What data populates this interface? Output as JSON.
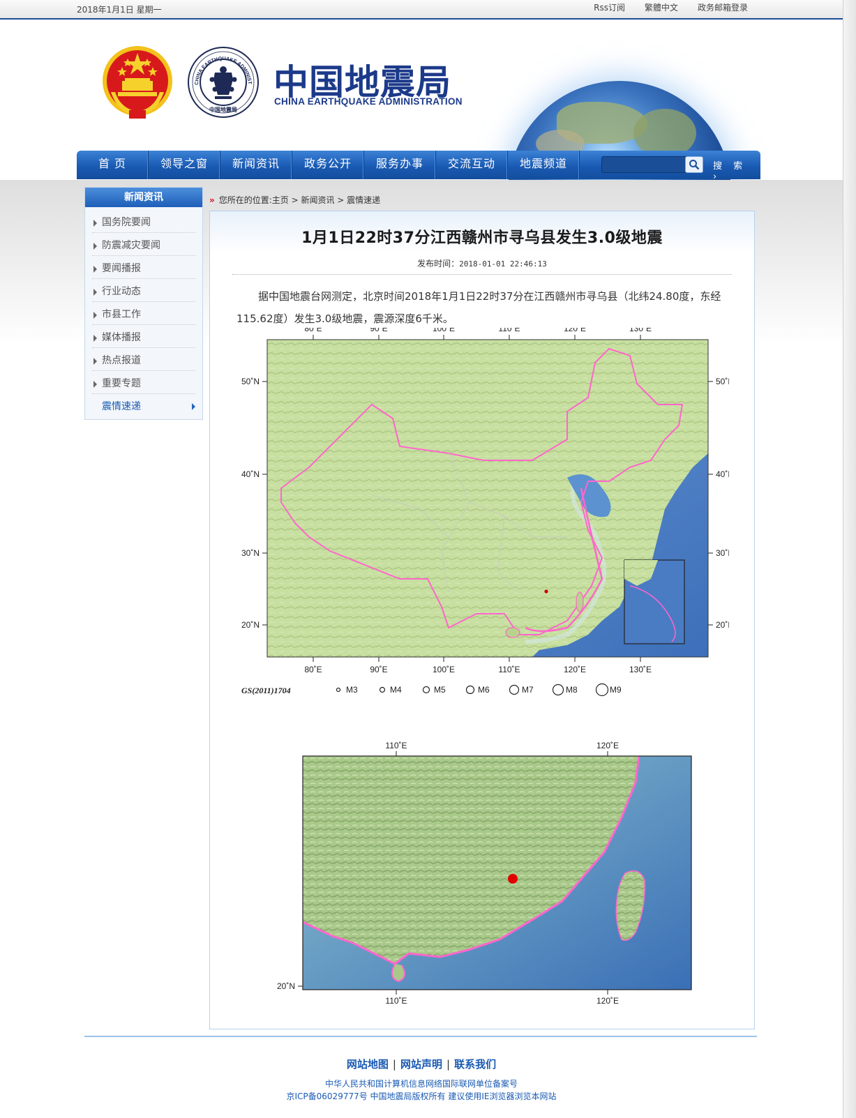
{
  "topbar": {
    "date": "2018年1月1日  星期一",
    "links": [
      "Rss订阅",
      "繁體中文",
      "政务邮箱登录"
    ]
  },
  "header": {
    "logo_cn": "中国地震局",
    "logo_en": "CHINA EARTHQUAKE ADMINISTRATION",
    "seal_text_top": "CHINA EARTHQUAKE ADMINISTRATION",
    "seal_text_bottom": "中国地震局"
  },
  "nav": {
    "items": [
      "首  页",
      "领导之窗",
      "新闻资讯",
      "政务公开",
      "服务办事",
      "交流互动",
      "地震频道"
    ],
    "search_placeholder": "",
    "search_label": "搜 索 ›"
  },
  "sidebar": {
    "title": "新闻资讯",
    "items": [
      "国务院要闻",
      "防震减灾要闻",
      "要闻播报",
      "行业动态",
      "市县工作",
      "媒体播报",
      "热点报道",
      "重要专题",
      "震情速递"
    ],
    "active_index": 8
  },
  "breadcrumb": {
    "marker": "»",
    "text": "您所在的位置:主页 > 新闻资讯 > 震情速递"
  },
  "article": {
    "title": "1月1日22时37分江西赣州市寻乌县发生3.0级地震",
    "pub_label": "发布时间：",
    "pub_time": "2018-01-01 22:46:13",
    "body": "据中国地震台网测定，北京时间2018年1月1日22时37分在江西赣州市寻乌县（北纬24.80度，东经115.62度）发生3.0级地震，震源深度6千米。"
  },
  "map1": {
    "lon_ticks": [
      "80˚E",
      "90˚E",
      "100˚E",
      "110˚E",
      "120˚E",
      "130˚E"
    ],
    "lat_ticks": [
      "50˚N",
      "40˚N",
      "30˚N",
      "20˚N"
    ],
    "map_code": "GS(2011)1704",
    "magnitude_legend": [
      "M3",
      "M4",
      "M5",
      "M6",
      "M7",
      "M8",
      "M9"
    ],
    "epicenter_color": "#cc0000",
    "border_color": "#ff66cc"
  },
  "map2": {
    "lon_ticks": [
      "110˚E",
      "120˚E"
    ],
    "lat_ticks": [
      "20˚N"
    ],
    "epicenter_color": "#e00000"
  },
  "footer": {
    "links": [
      "网站地图",
      "网站声明",
      "联系我们"
    ],
    "line1": "中华人民共和国计算机信息网络国际联网单位备案号",
    "line2": "京ICP备06029777号  中国地震局版权所有  建议使用IE浏览器浏览本网站"
  },
  "colors": {
    "nav_blue": "#1a5ab3",
    "link_blue": "#1a5ab3",
    "breadcrumb_marker": "#d0101a"
  }
}
